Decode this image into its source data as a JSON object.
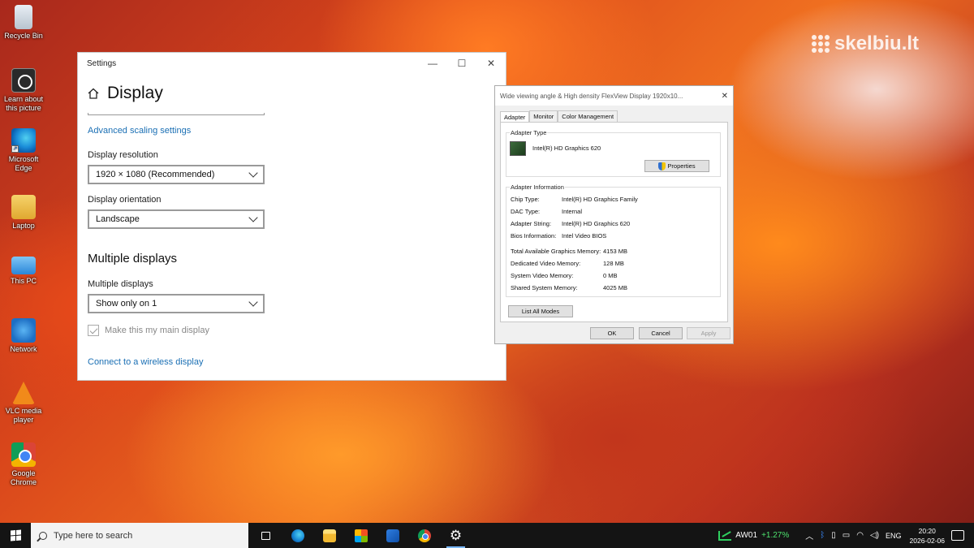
{
  "desktop": {
    "icons": [
      {
        "label": "Recycle Bin"
      },
      {
        "label": "Learn about this picture"
      },
      {
        "label": "Microsoft Edge"
      },
      {
        "label": "Laptop"
      },
      {
        "label": "This PC"
      },
      {
        "label": "Network"
      },
      {
        "label": "VLC media player"
      },
      {
        "label": "Google Chrome"
      }
    ],
    "watermark": "skelbiu.lt"
  },
  "settings": {
    "window_title": "Settings",
    "page_title": "Display",
    "advanced_scaling_link": "Advanced scaling settings",
    "resolution_label": "Display resolution",
    "resolution_value": "1920 × 1080 (Recommended)",
    "orientation_label": "Display orientation",
    "orientation_value": "Landscape",
    "multiple_heading": "Multiple displays",
    "multiple_label": "Multiple displays",
    "multiple_value": "Show only on 1",
    "main_display_checkbox": "Make this my main display",
    "main_display_checked": true,
    "wireless_link": "Connect to a wireless display"
  },
  "adapter_dialog": {
    "title": "Wide viewing angle & High density FlexView Display 1920x10...",
    "tabs": [
      "Adapter",
      "Monitor",
      "Color Management"
    ],
    "active_tab": "Adapter",
    "adapter_type_title": "Adapter Type",
    "adapter_name": "Intel(R) HD Graphics 620",
    "properties_button": "Properties",
    "info_title": "Adapter Information",
    "info_rows": [
      {
        "k": "Chip Type:",
        "v": "Intel(R) HD Graphics Family"
      },
      {
        "k": "DAC Type:",
        "v": "Internal"
      },
      {
        "k": "Adapter String:",
        "v": "Intel(R) HD Graphics 620"
      },
      {
        "k": "Bios Information:",
        "v": "Intel Video BIOS"
      }
    ],
    "memory_rows": [
      {
        "k": "Total Available Graphics Memory:",
        "v": "4153 MB"
      },
      {
        "k": "Dedicated Video Memory:",
        "v": "128 MB"
      },
      {
        "k": "System Video Memory:",
        "v": "0 MB"
      },
      {
        "k": "Shared System Memory:",
        "v": "4025 MB"
      }
    ],
    "list_modes_button": "List All Modes",
    "ok_button": "OK",
    "cancel_button": "Cancel",
    "apply_button": "Apply"
  },
  "taskbar": {
    "search_placeholder": "Type here to search",
    "stock_ticker": "AW01",
    "stock_change": "+1.27%",
    "language": "ENG",
    "time": "20:20",
    "date": "2026-02-06"
  },
  "colors": {
    "link": "#1a6fb4",
    "taskbar": "#141414",
    "stock_up": "#4ee36f"
  }
}
